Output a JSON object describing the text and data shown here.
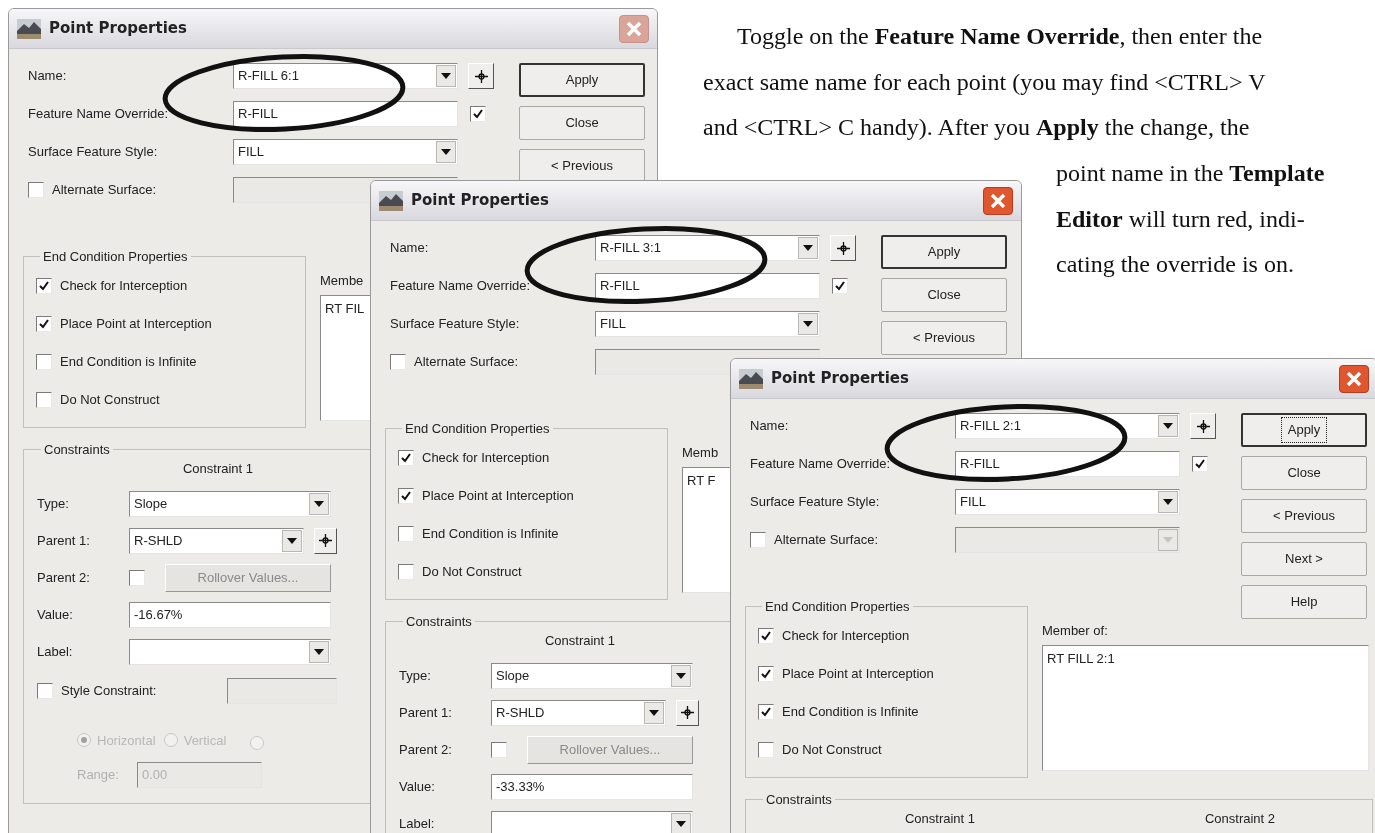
{
  "paragraph": {
    "top_lines": [
      "Toggle on the **Feature Name Override**, then enter the",
      "exact same name for each point (you may find <CTRL> V",
      "and <CTRL> C handy). After you **Apply** the change, the"
    ],
    "side_lines": [
      "point name in the **Template**",
      "**Editor** will turn red, indi-",
      "cating the override is on."
    ]
  },
  "dialogs": [
    {
      "title": "Point Properties",
      "active": false,
      "circled": true,
      "fields": [
        {
          "kind": "combo",
          "label": "Name:",
          "value": "R-FILL 6:1",
          "pick": true
        },
        {
          "kind": "text",
          "label": "Feature Name Override:",
          "value": "R-FILL",
          "checked": true
        },
        {
          "kind": "combo",
          "label": "Surface Feature Style:",
          "value": "FILL"
        },
        {
          "kind": "check-field",
          "label": "Alternate Surface:",
          "checked": false,
          "disabled": true
        }
      ],
      "buttons": [
        {
          "label": "Apply",
          "default": true,
          "focused": false
        },
        {
          "label": "Close",
          "default": false,
          "focused": false
        },
        {
          "label": "< Previous",
          "default": false,
          "focused": false
        }
      ],
      "end_condition": {
        "title": "End Condition Properties",
        "items": [
          {
            "label": "Check for Interception",
            "checked": true
          },
          {
            "label": "Place Point at Interception",
            "checked": true
          },
          {
            "label": "End Condition is Infinite",
            "checked": false
          },
          {
            "label": "Do Not Construct",
            "checked": false
          }
        ]
      },
      "member_of": {
        "label": "Membe",
        "items": [
          "RT FIL"
        ]
      },
      "constraints": {
        "title": "Constraints",
        "columns": [
          {
            "heading": "Constraint 1",
            "rows": [
              {
                "kind": "combo",
                "label": "Type:",
                "value": "Slope"
              },
              {
                "kind": "combo",
                "label": "Parent 1:",
                "value": "R-SHLD",
                "pick": true
              },
              {
                "kind": "parent2",
                "label": "Parent 2:",
                "checked": false,
                "button": "Rollover Values...",
                "disabled": true
              },
              {
                "kind": "text",
                "label": "Value:",
                "value": "-16.67%"
              },
              {
                "kind": "combo",
                "label": "Label:"
              },
              {
                "kind": "style",
                "label": "Style Constraint:",
                "checked": false
              },
              {
                "kind": "radios",
                "disabled": true,
                "options": [
                  {
                    "label": "Horizontal",
                    "selected": true
                  },
                  {
                    "label": "Vertical",
                    "selected": false
                  },
                  {
                    "selected": false
                  }
                ]
              },
              {
                "kind": "range",
                "label": "Range:",
                "value": "0.00",
                "disabled": true
              }
            ]
          }
        ]
      }
    },
    {
      "title": "Point Properties",
      "active": true,
      "circled": true,
      "fields": [
        {
          "kind": "combo",
          "label": "Name:",
          "value": "R-FILL 3:1",
          "pick": true
        },
        {
          "kind": "text",
          "label": "Feature Name Override:",
          "value": "R-FILL",
          "checked": true
        },
        {
          "kind": "combo",
          "label": "Surface Feature Style:",
          "value": "FILL"
        },
        {
          "kind": "check-field",
          "label": "Alternate Surface:",
          "checked": false,
          "disabled": true
        }
      ],
      "buttons": [
        {
          "label": "Apply",
          "default": true,
          "focused": false
        },
        {
          "label": "Close",
          "default": false,
          "focused": false
        },
        {
          "label": "< Previous",
          "default": false,
          "focused": false
        }
      ],
      "end_condition": {
        "title": "End Condition Properties",
        "items": [
          {
            "label": "Check for Interception",
            "checked": true
          },
          {
            "label": "Place Point at Interception",
            "checked": true
          },
          {
            "label": "End Condition is Infinite",
            "checked": false
          },
          {
            "label": "Do Not Construct",
            "checked": false
          }
        ]
      },
      "member_of": {
        "label": "Memb",
        "items": [
          "RT F"
        ]
      },
      "constraints": {
        "title": "Constraints",
        "columns": [
          {
            "heading": "Constraint 1",
            "rows": [
              {
                "kind": "combo",
                "label": "Type:",
                "value": "Slope"
              },
              {
                "kind": "combo",
                "label": "Parent 1:",
                "value": "R-SHLD",
                "pick": true
              },
              {
                "kind": "parent2",
                "label": "Parent 2:",
                "checked": false,
                "button": "Rollover Values...",
                "disabled": true
              },
              {
                "kind": "text",
                "label": "Value:",
                "value": "-33.33%"
              },
              {
                "kind": "combo",
                "label": "Label:"
              }
            ]
          }
        ]
      }
    },
    {
      "title": "Point Properties",
      "active": true,
      "circled": true,
      "fields": [
        {
          "kind": "combo",
          "label": "Name:",
          "value": "R-FILL 2:1",
          "pick": true
        },
        {
          "kind": "text",
          "label": "Feature Name Override:",
          "value": "R-FILL",
          "checked": true
        },
        {
          "kind": "combo",
          "label": "Surface Feature Style:",
          "value": "FILL"
        },
        {
          "kind": "check-combo",
          "label": "Alternate Surface:",
          "checked": false,
          "disabled": true
        }
      ],
      "buttons": [
        {
          "label": "Apply",
          "default": true,
          "focused": true
        },
        {
          "label": "Close",
          "default": false,
          "focused": false
        },
        {
          "label": "< Previous",
          "default": false,
          "focused": false
        },
        {
          "label": "Next >",
          "default": false,
          "focused": false
        },
        {
          "label": "Help",
          "default": false,
          "focused": false
        }
      ],
      "end_condition": {
        "title": "End Condition Properties",
        "items": [
          {
            "label": "Check for Interception",
            "checked": true
          },
          {
            "label": "Place Point at Interception",
            "checked": true
          },
          {
            "label": "End Condition is Infinite",
            "checked": true
          },
          {
            "label": "Do Not Construct",
            "checked": false
          }
        ]
      },
      "member_of": {
        "label": "Member of:",
        "items": [
          "RT FILL 2:1"
        ]
      },
      "constraints": {
        "title": "Constraints",
        "columns": [
          {
            "heading": "Constraint 1"
          },
          {
            "heading": "Constraint 2"
          }
        ]
      }
    }
  ]
}
